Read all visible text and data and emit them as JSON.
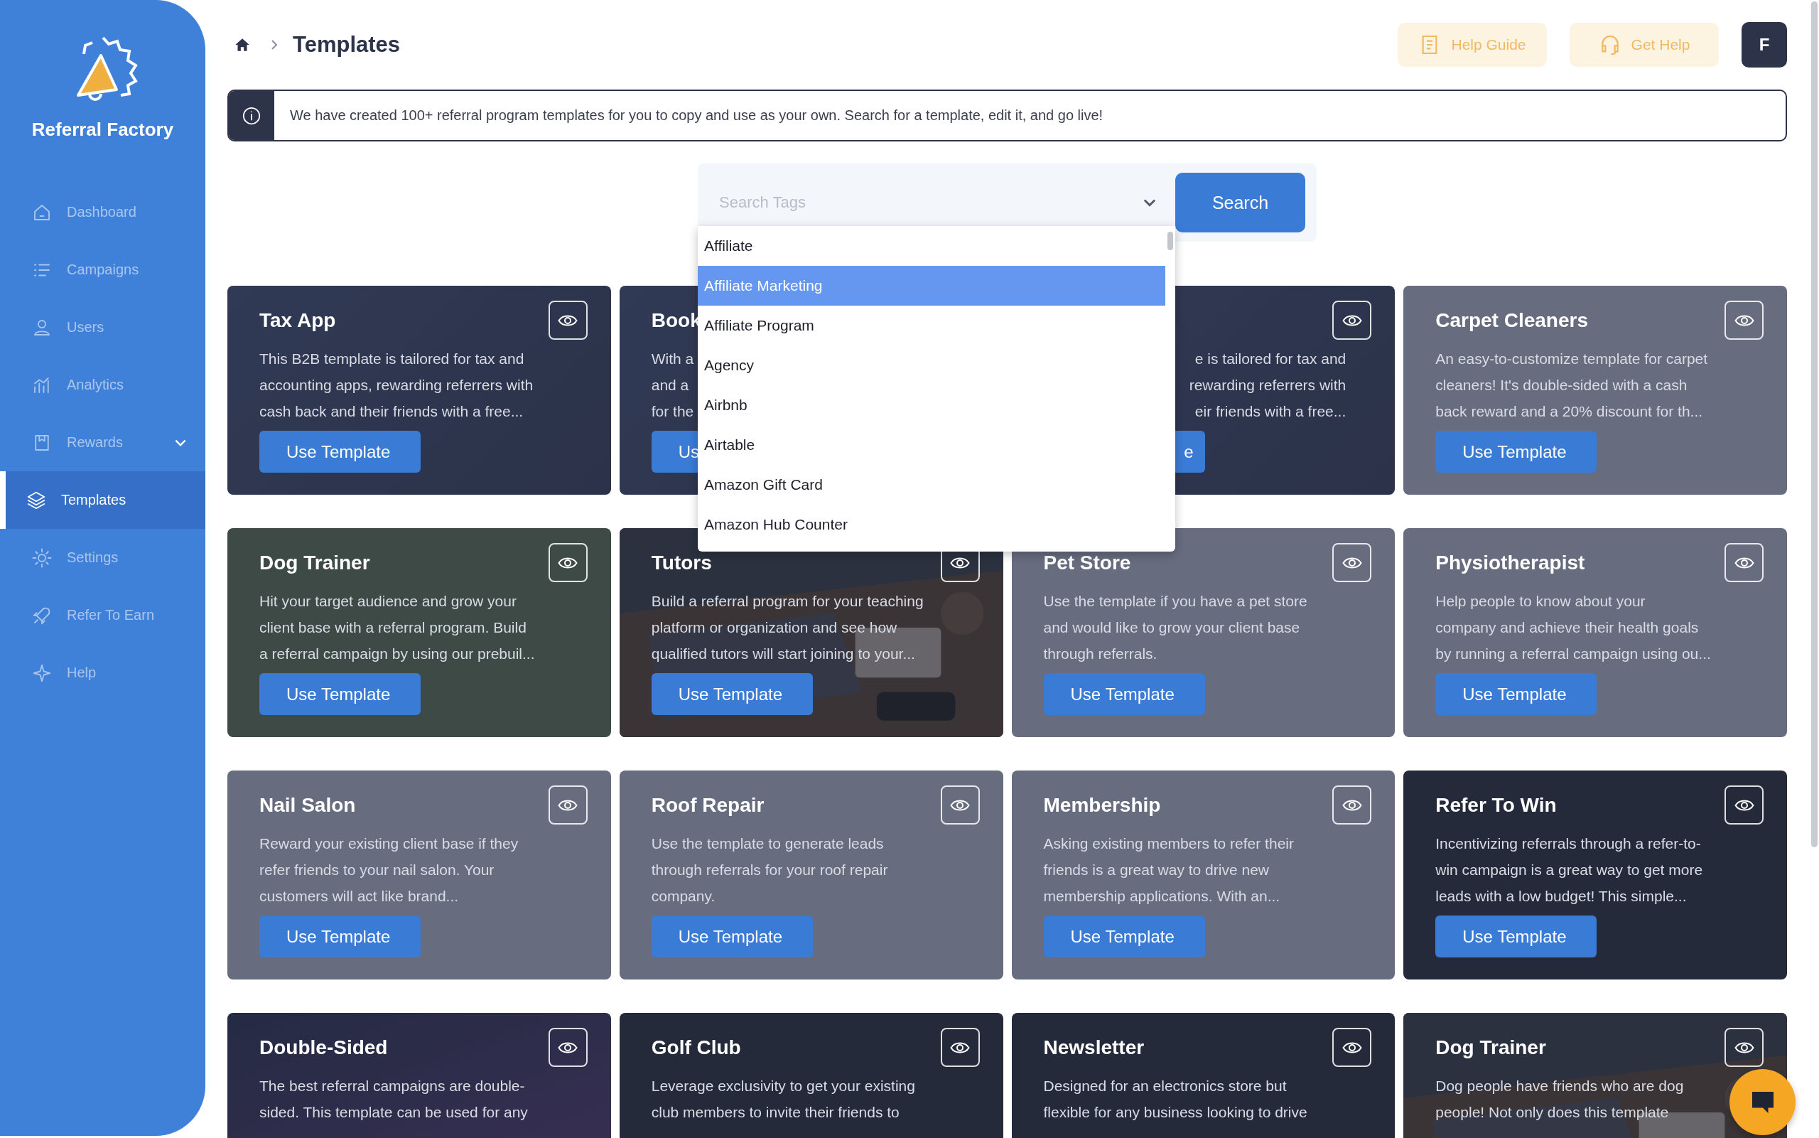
{
  "sidebar": {
    "brand": "Referral Factory",
    "items": [
      {
        "label": "Dashboard",
        "kind": "link",
        "selected": false
      },
      {
        "label": "Campaigns",
        "kind": "link",
        "selected": false
      },
      {
        "label": "Users",
        "kind": "link",
        "selected": false
      },
      {
        "label": "Analytics",
        "kind": "link",
        "selected": false
      },
      {
        "label": "Rewards",
        "kind": "group",
        "selected": false
      },
      {
        "label": "Templates",
        "kind": "link",
        "selected": true
      },
      {
        "label": "Settings",
        "kind": "link",
        "selected": false
      },
      {
        "label": "Refer To Earn",
        "kind": "link",
        "selected": false
      },
      {
        "label": "Help",
        "kind": "link",
        "selected": false
      }
    ]
  },
  "header": {
    "breadcrumb": "Templates",
    "buttons": [
      "Help Guide",
      "Get Help"
    ],
    "avatar": "F"
  },
  "notice": "We have created 100+ referral program templates for you to copy and use as your own. Search for a template, edit it, and go live!",
  "search": {
    "placeholder": "Search Tags",
    "button": "Search",
    "options": [
      {
        "label": "Affiliate",
        "selected": false
      },
      {
        "label": "Affiliate Marketing",
        "selected": true
      },
      {
        "label": "Affiliate Program",
        "selected": false
      },
      {
        "label": "Agency",
        "selected": false
      },
      {
        "label": "Airbnb",
        "selected": false
      },
      {
        "label": "Airtable",
        "selected": false
      },
      {
        "label": "Amazon Gift Card",
        "selected": false
      },
      {
        "label": "Amazon Hub Counter",
        "selected": false
      }
    ]
  },
  "cards": [
    {
      "kind": "navy",
      "title": "Tax App",
      "preview_icon": true,
      "lines": [
        "This B2B template is tailored for tax and",
        "accounting apps, rewarding referrers with",
        "cash back and their friends with a free..."
      ],
      "button": "Use Template"
    },
    {
      "kind": "navy",
      "title": "Book",
      "preview_icon": false,
      "lines": [
        "With a",
        "and a",
        "for the"
      ],
      "button": "Us"
    },
    {
      "kind": "navy",
      "cut_left": true,
      "preview_icon": true,
      "lines": [
        "e is tailored for tax and",
        "rewarding referrers with",
        "eir friends with a free..."
      ],
      "button": "e"
    },
    {
      "kind": "slate",
      "title": "Carpet Cleaners",
      "preview_icon": true,
      "lines": [
        "An easy-to-customize template for carpet",
        "cleaners! It's double-sided with a cash",
        "back reward and a 20% discount for th..."
      ],
      "button": "Use Template"
    },
    {
      "kind": "forest",
      "title": "Dog Trainer",
      "preview_icon": true,
      "lines": [
        "Hit your target audience and grow your",
        "client base with a referral program. Build",
        "a referral campaign by using our prebuil..."
      ],
      "button": "Use Template"
    },
    {
      "title": "Tutors",
      "preview_icon": true,
      "lines": [
        "Build a referral program for your teaching",
        "platform or organization and see how",
        "qualified tutors will start joining to your..."
      ],
      "button": "Use Template"
    },
    {
      "kind": "slate",
      "title": "Pet Store",
      "preview_icon": true,
      "lines": [
        "Use the template if you have a pet store",
        "and would like to grow your client base",
        "through referrals."
      ],
      "button": "Use Template"
    },
    {
      "kind": "slate",
      "title": "Physiotherapist",
      "preview_icon": true,
      "lines": [
        "Help people to know about your",
        "company and achieve their health goals",
        "by running a referral campaign using ou..."
      ],
      "button": "Use Template"
    },
    {
      "kind": "slate",
      "title": "Nail Salon",
      "preview_icon": true,
      "lines": [
        "Reward your existing client base if they",
        "refer friends to your nail salon. Your",
        "customers will act like brand..."
      ],
      "button": "Use Template"
    },
    {
      "kind": "slate",
      "title": "Roof Repair",
      "preview_icon": true,
      "lines": [
        "Use the template to generate leads",
        "through referrals for your roof repair",
        "company."
      ],
      "button": "Use Template"
    },
    {
      "kind": "slate",
      "title": "Membership",
      "preview_icon": true,
      "lines": [
        "Asking existing members to refer their",
        "friends is a great way to drive new",
        "membership applications. With an..."
      ],
      "button": "Use Template"
    },
    {
      "kind": "dark",
      "title": "Refer To Win",
      "preview_icon": true,
      "lines": [
        "Incentivizing referrals through a refer-to-",
        "win campaign is a great way to get more",
        "leads with a low budget! This simple..."
      ],
      "button": "Use Template"
    },
    {
      "kind": "dusk",
      "title": "Double-Sided",
      "preview_icon": true,
      "lines": [
        "The best referral campaigns are double-",
        "sided. This template can be used for any"
      ]
    },
    {
      "kind": "dark",
      "title": "Golf Club",
      "preview_icon": true,
      "lines": [
        "Leverage exclusivity to get your existing",
        "club members to invite their friends to"
      ]
    },
    {
      "kind": "dark",
      "title": "Newsletter",
      "preview_icon": true,
      "lines": [
        "Designed for an electronics store but",
        "flexible for any business looking to drive"
      ]
    },
    {
      "title": "Dog Trainer",
      "preview_icon": true,
      "lines": [
        "Dog people have friends who are dog",
        "people! Not only does this template"
      ]
    }
  ]
}
